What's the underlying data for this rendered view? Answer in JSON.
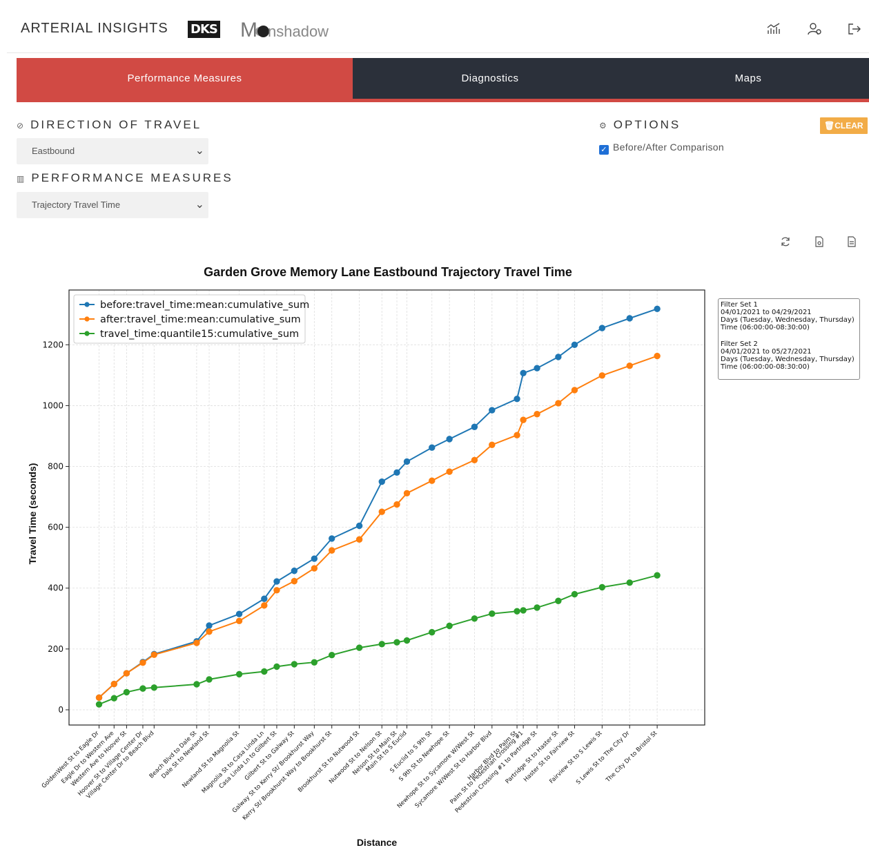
{
  "header": {
    "brand": "ARTERIAL INSIGHTS",
    "logo1": "DKS",
    "logo2_m": "M",
    "logo2_rest": "nshadow",
    "icons": [
      "chart-icon",
      "user-settings-icon",
      "logout-icon"
    ]
  },
  "tabs": [
    {
      "label": "Performance Measures",
      "active": true
    },
    {
      "label": "Diagnostics",
      "active": false
    },
    {
      "label": "Maps",
      "active": false
    }
  ],
  "direction": {
    "heading": "DIRECTION OF TRAVEL",
    "selected": "Eastbound"
  },
  "measures": {
    "heading": "PERFORMANCE MEASURES",
    "selected": "Trajectory Travel Time"
  },
  "options": {
    "heading": "OPTIONS",
    "checkbox_label": "Before/After Comparison",
    "checked": true,
    "clear_label": "CLEAR"
  },
  "filter_sets": {
    "set1": [
      "Filter Set 1",
      "04/01/2021 to 04/29/2021",
      "Days (Tuesday, Wednesday, Thursday)",
      "Time (06:00:00-08:30:00)"
    ],
    "set2": [
      "Filter Set 2",
      "04/01/2021 to 05/27/2021",
      "Days (Tuesday, Wednesday, Thursday)",
      "Time (06:00:00-08:30:00)"
    ]
  },
  "colors": {
    "accent": "#d14a44",
    "dark": "#2b303a",
    "clear": "#f2ac47",
    "series": [
      "#1f77b4",
      "#ff7f0e",
      "#2ca02c"
    ]
  },
  "chart_data": {
    "type": "line",
    "title": "Garden Grove Memory Lane Eastbound Trajectory Travel Time",
    "xlabel": "Distance",
    "ylabel": "Travel Time (seconds)",
    "ylim": [
      -50,
      1380
    ],
    "yticks": [
      0,
      200,
      400,
      600,
      800,
      1000,
      1200
    ],
    "grid": true,
    "legend_position": "upper-left",
    "x": [
      0,
      0.6,
      1.1,
      1.75,
      2.2,
      3.9,
      4.4,
      5.6,
      6.6,
      7.1,
      7.8,
      8.6,
      9.3,
      10.4,
      11.3,
      11.9,
      12.3,
      13.3,
      14.0,
      15.0,
      15.7,
      16.7,
      16.95,
      17.5,
      18.35,
      19.0,
      20.1,
      21.2,
      22.3
    ],
    "x_positions_labels": [
      {
        "x": 0,
        "label": "GoldenWest St to Eagle Dr"
      },
      {
        "x": 0.6,
        "label": "Eagle Dr to Western Ave"
      },
      {
        "x": 1.1,
        "label": "Western Ave to Hoover St"
      },
      {
        "x": 1.75,
        "label": "Hoover St to Village Center Dr"
      },
      {
        "x": 2.2,
        "label": "Village Center Dr to Beach Blvd"
      },
      {
        "x": 3.9,
        "label": "Beach Blvd to Dale St"
      },
      {
        "x": 4.4,
        "label": "Dale St to Newland St"
      },
      {
        "x": 5.6,
        "label": "Newland St to Magnolia St"
      },
      {
        "x": 6.6,
        "label": "Magnolia St to Casa Linda Ln"
      },
      {
        "x": 7.1,
        "label": "Casa Linda Ln to Gilbert St"
      },
      {
        "x": 7.8,
        "label": "Gilbert St to Galway St"
      },
      {
        "x": 8.6,
        "label": "Galway St to Kerry St/ Brookhurst Way"
      },
      {
        "x": 9.3,
        "label": "Kerry St/ Brookhurst Way to Brookhurst St"
      },
      {
        "x": 10.4,
        "label": "Brookhurst St to Nutwood St"
      },
      {
        "x": 11.3,
        "label": "Nutwood St to Nelson St"
      },
      {
        "x": 11.9,
        "label": "Nelson St to Main St"
      },
      {
        "x": 12.3,
        "label": "Main St to S Euclid"
      },
      {
        "x": 13.3,
        "label": "S Euclid to S 9th St"
      },
      {
        "x": 14.0,
        "label": "S 9th St to Newhope St"
      },
      {
        "x": 15.0,
        "label": "Newhope St to Sycamore W/West St"
      },
      {
        "x": 15.7,
        "label": "Sycamore W/West St to Harbor Blvd"
      },
      {
        "x": 16.7,
        "label": "Harbor Blvd to Palm St"
      },
      {
        "x": 16.95,
        "label": "Palm St to Pedestrian Crossing #1"
      },
      {
        "x": 17.5,
        "label": "Pedestrian Crossing #1 to Partridge St"
      },
      {
        "x": 18.35,
        "label": "Partridge St to Haster St"
      },
      {
        "x": 19.0,
        "label": "Haster St to Fairview St"
      },
      {
        "x": 20.1,
        "label": "Fairview St to S Lewis St"
      },
      {
        "x": 21.2,
        "label": "S Lewis St to The City Dr"
      },
      {
        "x": 22.3,
        "label": "The City Dr to Bristol St"
      }
    ],
    "series": [
      {
        "name": "before:travel_time:mean:cumulative_sum",
        "values": [
          40,
          85,
          120,
          157,
          183,
          225,
          277,
          315,
          365,
          422,
          457,
          497,
          563,
          605,
          750,
          780,
          816,
          862,
          890,
          930,
          985,
          1022,
          1107,
          1123,
          1160,
          1200,
          1255,
          1287,
          1318
        ]
      },
      {
        "name": "after:travel_time:mean:cumulative_sum",
        "values": [
          40,
          85,
          120,
          155,
          181,
          220,
          257,
          292,
          343,
          393,
          423,
          465,
          524,
          560,
          651,
          675,
          712,
          753,
          783,
          821,
          871,
          903,
          953,
          972,
          1008,
          1051,
          1099,
          1131,
          1163
        ]
      },
      {
        "name": "travel_time:quantile15:cumulative_sum",
        "values": [
          18,
          38,
          58,
          70,
          73,
          84,
          100,
          117,
          126,
          142,
          150,
          156,
          180,
          204,
          216,
          222,
          228,
          255,
          276,
          300,
          316,
          324,
          327,
          336,
          358,
          380,
          403,
          418,
          442
        ]
      }
    ]
  }
}
